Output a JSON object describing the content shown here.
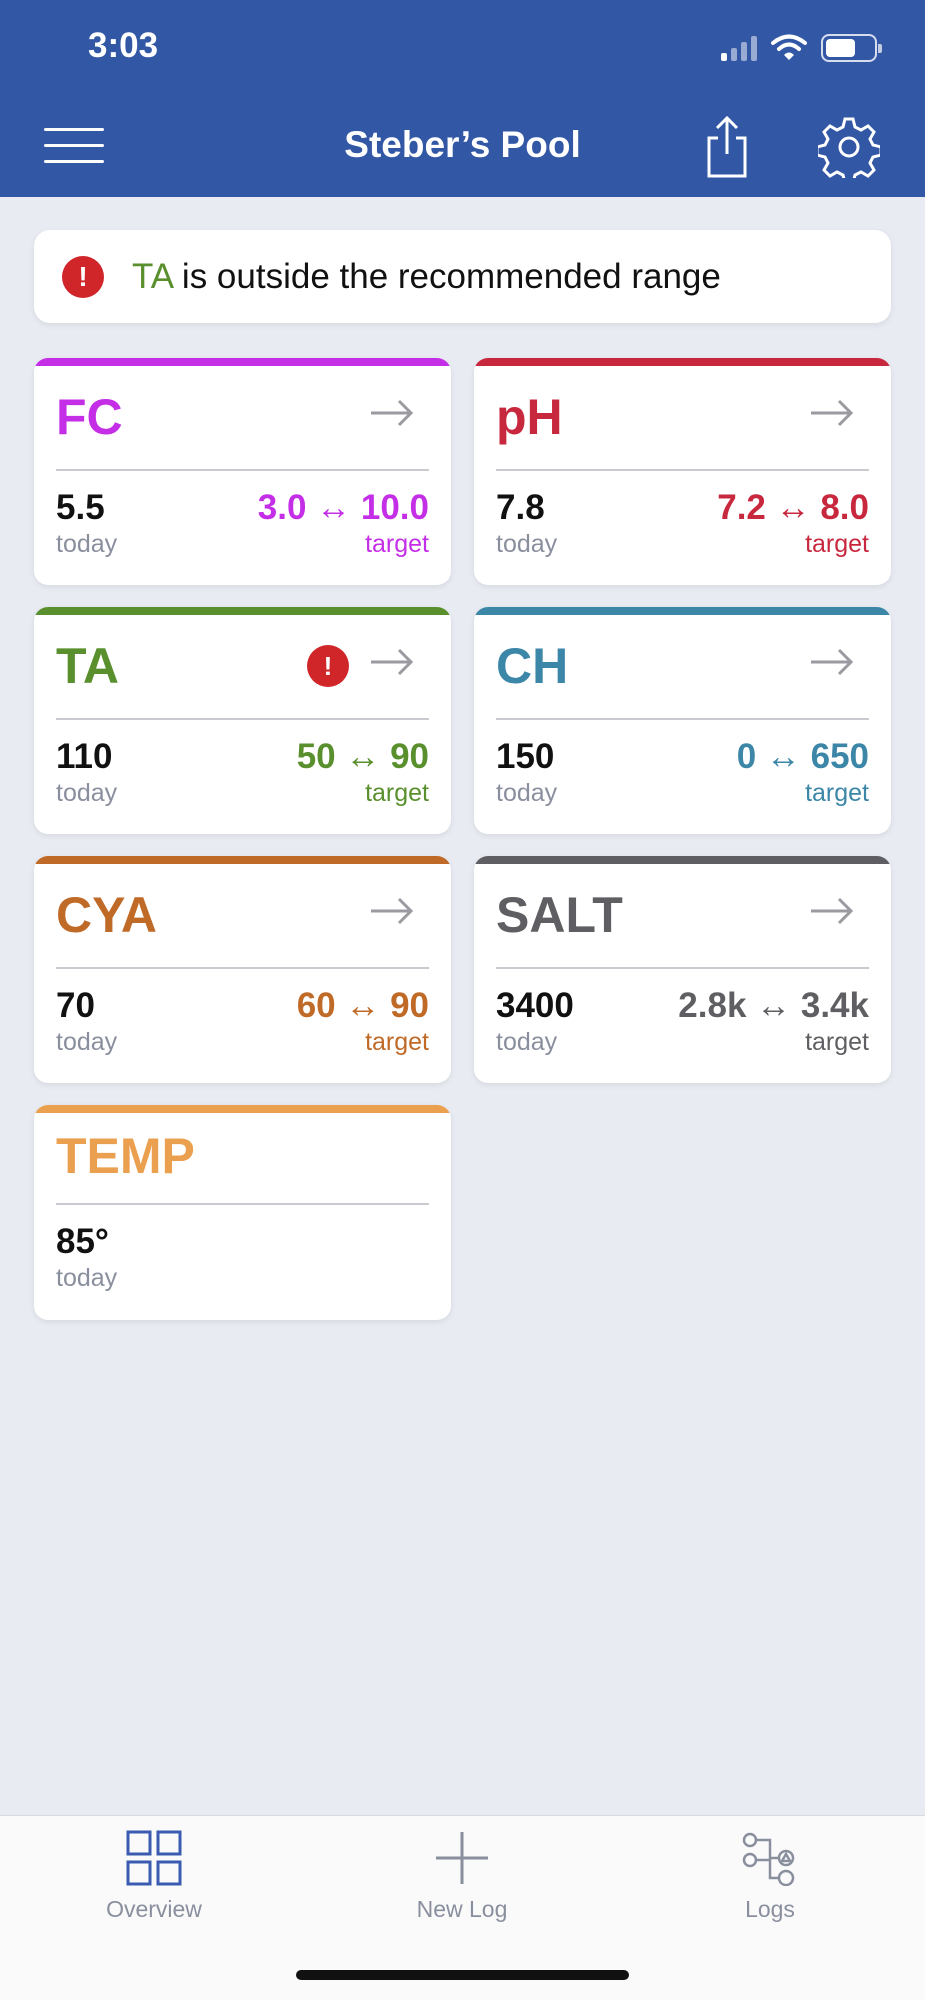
{
  "status": {
    "time": "3:03"
  },
  "header": {
    "title": "Steber’s Pool"
  },
  "alert": {
    "param": "TA",
    "text": " is outside the recommended range"
  },
  "colors": {
    "header_bg": "#3257a5",
    "fc": "#c42ee6",
    "ph": "#c8283e",
    "ta": "#5a8f2e",
    "ch": "#3c86a8",
    "cya": "#c06a28",
    "salt": "#5f5f63",
    "temp": "#eba050"
  },
  "cards": [
    {
      "name": "FC",
      "value": "5.5",
      "value_sub": "today",
      "range": "3.0 ↔ 10.0",
      "range_sub": "target"
    },
    {
      "name": "pH",
      "value": "7.8",
      "value_sub": "today",
      "range": "7.2 ↔ 8.0",
      "range_sub": "target"
    },
    {
      "name": "TA",
      "value": "110",
      "value_sub": "today",
      "range": "50 ↔ 90",
      "range_sub": "target",
      "warning": "!"
    },
    {
      "name": "CH",
      "value": "150",
      "value_sub": "today",
      "range": "0 ↔ 650",
      "range_sub": "target"
    },
    {
      "name": "CYA",
      "value": "70",
      "value_sub": "today",
      "range": "60 ↔ 90",
      "range_sub": "target"
    },
    {
      "name": "SALT",
      "value": "3400",
      "value_sub": "today",
      "range": "2.8k ↔ 3.4k",
      "range_sub": "target"
    },
    {
      "name": "TEMP",
      "value": "85°",
      "value_sub": "today"
    }
  ],
  "tabs": [
    {
      "label": "Overview",
      "icon": "grid-icon"
    },
    {
      "label": "New Log",
      "icon": "plus-icon"
    },
    {
      "label": "Logs",
      "icon": "logs-icon"
    }
  ]
}
